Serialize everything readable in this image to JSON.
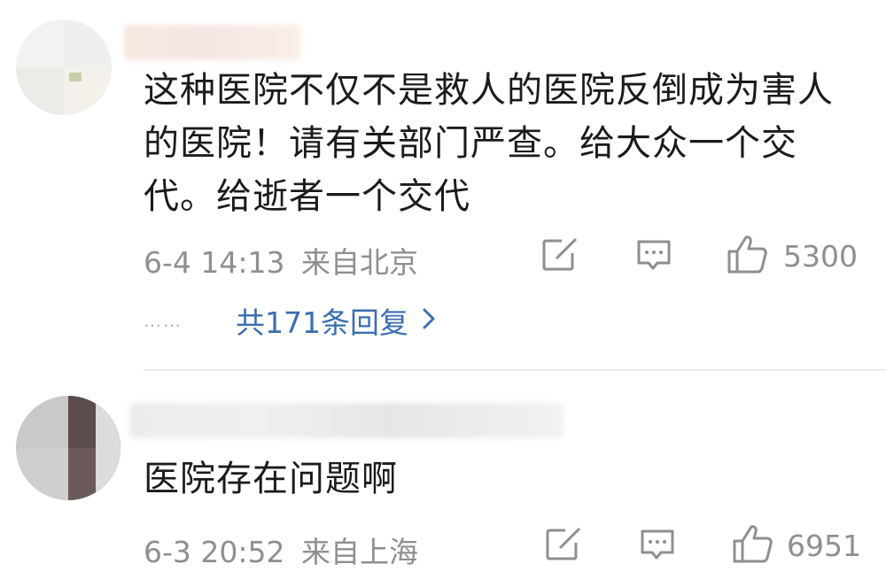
{
  "comments": [
    {
      "text": "这种医院不仅不是救人的医院反倒成为害人的医院！请有关部门严查。给大众一个交代。给逝者一个交代",
      "time": "6-4 14:13",
      "location": "来自北京",
      "likes": "5300",
      "replies_label": "共171条回复",
      "replies_dots": "……",
      "icons": {
        "share": "share-icon",
        "comment": "comment-icon",
        "like": "thumbs-up-icon",
        "chevron": "chevron-right-icon"
      }
    },
    {
      "text": "医院存在问题啊",
      "time": "6-3 20:52",
      "location": "来自上海",
      "likes": "6951",
      "icons": {
        "share": "share-icon",
        "comment": "comment-icon",
        "like": "thumbs-up-icon"
      }
    }
  ],
  "colors": {
    "text": "#1b1b1b",
    "meta": "#8f8f8f",
    "link": "#3a6fb0",
    "divider": "#ececec"
  }
}
